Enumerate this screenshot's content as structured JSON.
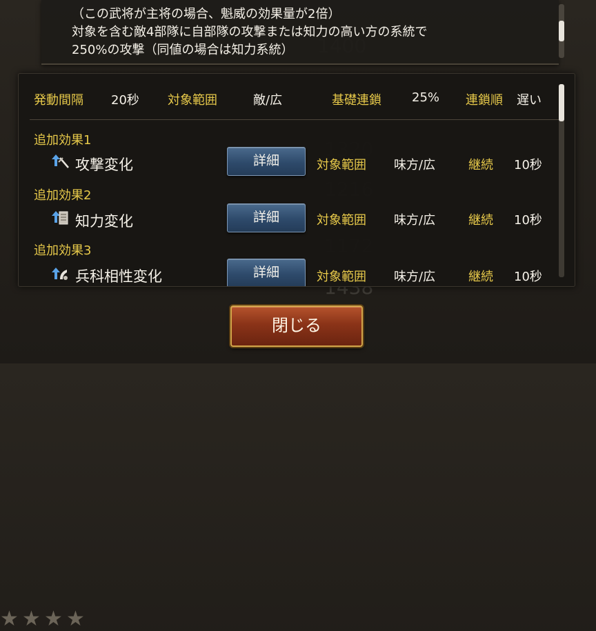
{
  "description_lines": [
    "（この武将が主将の場合、魁威の効果量が2倍）",
    "対象を含む敵4部隊に自部隊の攻撃または知力の高い方の系統で",
    "250%の攻撃（同値の場合は知力系統）"
  ],
  "stats": {
    "interval_label": "発動間隔",
    "interval_value": "20秒",
    "range_label": "対象範囲",
    "range_value": "敵/広",
    "chain_label": "基礎連鎖",
    "chain_value": "25%",
    "order_label": "連鎖順",
    "order_value": "遅い"
  },
  "effects": [
    {
      "title": "追加効果1",
      "icon": "attack-up-icon",
      "name": "攻撃変化",
      "detail_label": "詳細",
      "range_label": "対象範囲",
      "range_value": "味方/広",
      "duration_label": "継続",
      "duration_value": "10秒"
    },
    {
      "title": "追加効果2",
      "icon": "intellect-up-icon",
      "name": "知力変化",
      "detail_label": "詳細",
      "range_label": "対象範囲",
      "range_value": "味方/広",
      "duration_label": "継続",
      "duration_value": "10秒"
    },
    {
      "title": "追加効果3",
      "icon": "unit-affinity-up-icon",
      "name": "兵科相性変化",
      "detail_label": "詳細",
      "range_label": "対象範囲",
      "range_value": "味方/広",
      "duration_label": "継続",
      "duration_value": "10秒"
    }
  ],
  "close_label": "閉じる",
  "colors": {
    "label_gold": "#e7c94a",
    "text": "#f5f1e8",
    "button_blue": "#2e4a6b",
    "close_red": "#8a3318"
  }
}
